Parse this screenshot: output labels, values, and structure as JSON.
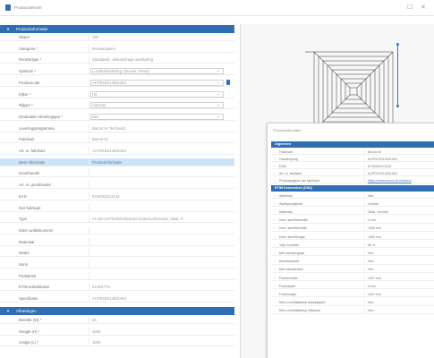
{
  "window": {
    "title": "Productselectie"
  },
  "left_panel": {
    "sections": [
      {
        "label": "Productinformatie"
      },
      {
        "label": "Afmetingen"
      }
    ],
    "rows": [
      {
        "label": "Object",
        "value": "168"
      },
      {
        "label": "Categorie *",
        "value": "Roosterplaten"
      },
      {
        "label": "Roostertype *",
        "value": "Standaard, vierkantsrage aansluiting"
      },
      {
        "label": "Systeem *",
        "value": "Luchtbehandeling (toevoer, retour)"
      },
      {
        "label": "Productcode",
        "value": "ACPDH0313001454"
      },
      {
        "label": "Kijker *",
        "value": "Uit"
      },
      {
        "label": "Rijtype *",
        "value": "Aanvoer"
      },
      {
        "label": "Omdraaiën stromingspar *",
        "value": "Nee"
      },
      {
        "label": "Leveringsprogramma",
        "value": "Barcol Air Technisch"
      },
      {
        "label": "Fabrikant",
        "value": "Barcol Air"
      },
      {
        "label": "Art. nr. fabrikant",
        "value": "ACPDH0313001454"
      },
      {
        "label": "Meer informatie",
        "value": "Productinformatie"
      },
      {
        "label": "Groothandel",
        "value": ""
      },
      {
        "label": "Art. nr. groothandel",
        "value": ""
      },
      {
        "label": "EAN",
        "value": "8718452313143"
      },
      {
        "label": "DUI fabrikant",
        "value": ""
      },
      {
        "label": "Type",
        "value": "AC,90-ACPDH0313001454 buitenluchtrooster, staal, P"
      },
      {
        "label": "Intern artikelnummer",
        "value": ""
      },
      {
        "label": "Materiaal",
        "value": ""
      },
      {
        "label": "Model",
        "value": ""
      },
      {
        "label": "Norm",
        "value": ""
      },
      {
        "label": "Prefabriek",
        "value": ""
      },
      {
        "label": "ETIM artikelklasse",
        "value": "EC001775"
      },
      {
        "label": "Specificatie",
        "value": "ACPDH0313001454"
      },
      {
        "label": "Breedte (W) *",
        "value": "25"
      },
      {
        "label": "Hoogte (H) *",
        "value": "1000"
      },
      {
        "label": "Lengte (L) *",
        "value": "1000"
      }
    ]
  },
  "popup": {
    "title": "Productinformatie",
    "sections": [
      {
        "label": "Algemeen"
      },
      {
        "label": "ETIM Kenmerken (DS8)"
      }
    ],
    "rows": [
      {
        "label": "Fabrikant",
        "value": "Barcol Air"
      },
      {
        "label": "Omschrijving",
        "value": "ACPDH0313001454"
      },
      {
        "label": "EAN",
        "value": "8718452313143"
      },
      {
        "label": "Art. nr. fabrikant",
        "value": "ACPDH0313001454"
      },
      {
        "label": "Productpagina van fabrikant",
        "value": "https://www.barcol-air.nl/barcol"
      },
      {
        "label": "Afdekkap",
        "value": "Nee"
      },
      {
        "label": "Afdekpublijkheid",
        "value": "Lichtwit"
      },
      {
        "label": "Materiaal",
        "value": "Staal, verzinkt"
      },
      {
        "label": "Nom. lamellibreedte",
        "value": "5 mm"
      },
      {
        "label": "Nom. lamellbreedte",
        "value": "1000 mm"
      },
      {
        "label": "Nom. lamelllengte",
        "value": "1000 mm"
      },
      {
        "label": "Vrije Doorlaat",
        "value": "65 %"
      },
      {
        "label": "Met insectengaas",
        "value": "Nee"
      },
      {
        "label": "Muurbeslaard",
        "value": "Nee"
      },
      {
        "label": "Met inbouwraam",
        "value": "Nee"
      },
      {
        "label": "Frontbreedte",
        "value": "1007 mm"
      },
      {
        "label": "Frontdiepte",
        "value": "5 mm"
      },
      {
        "label": "Fronthoogte",
        "value": "1007 mm"
      },
      {
        "label": "Met o-ventilatieklep aansluitgord",
        "value": "Nee"
      },
      {
        "label": "Met o-ventilatieklep uittaaunt",
        "value": "Nee"
      }
    ]
  },
  "colors": {
    "accent": "#2f6eb3",
    "selected_row": "#cde3f6",
    "link": "#3c7fc4"
  }
}
